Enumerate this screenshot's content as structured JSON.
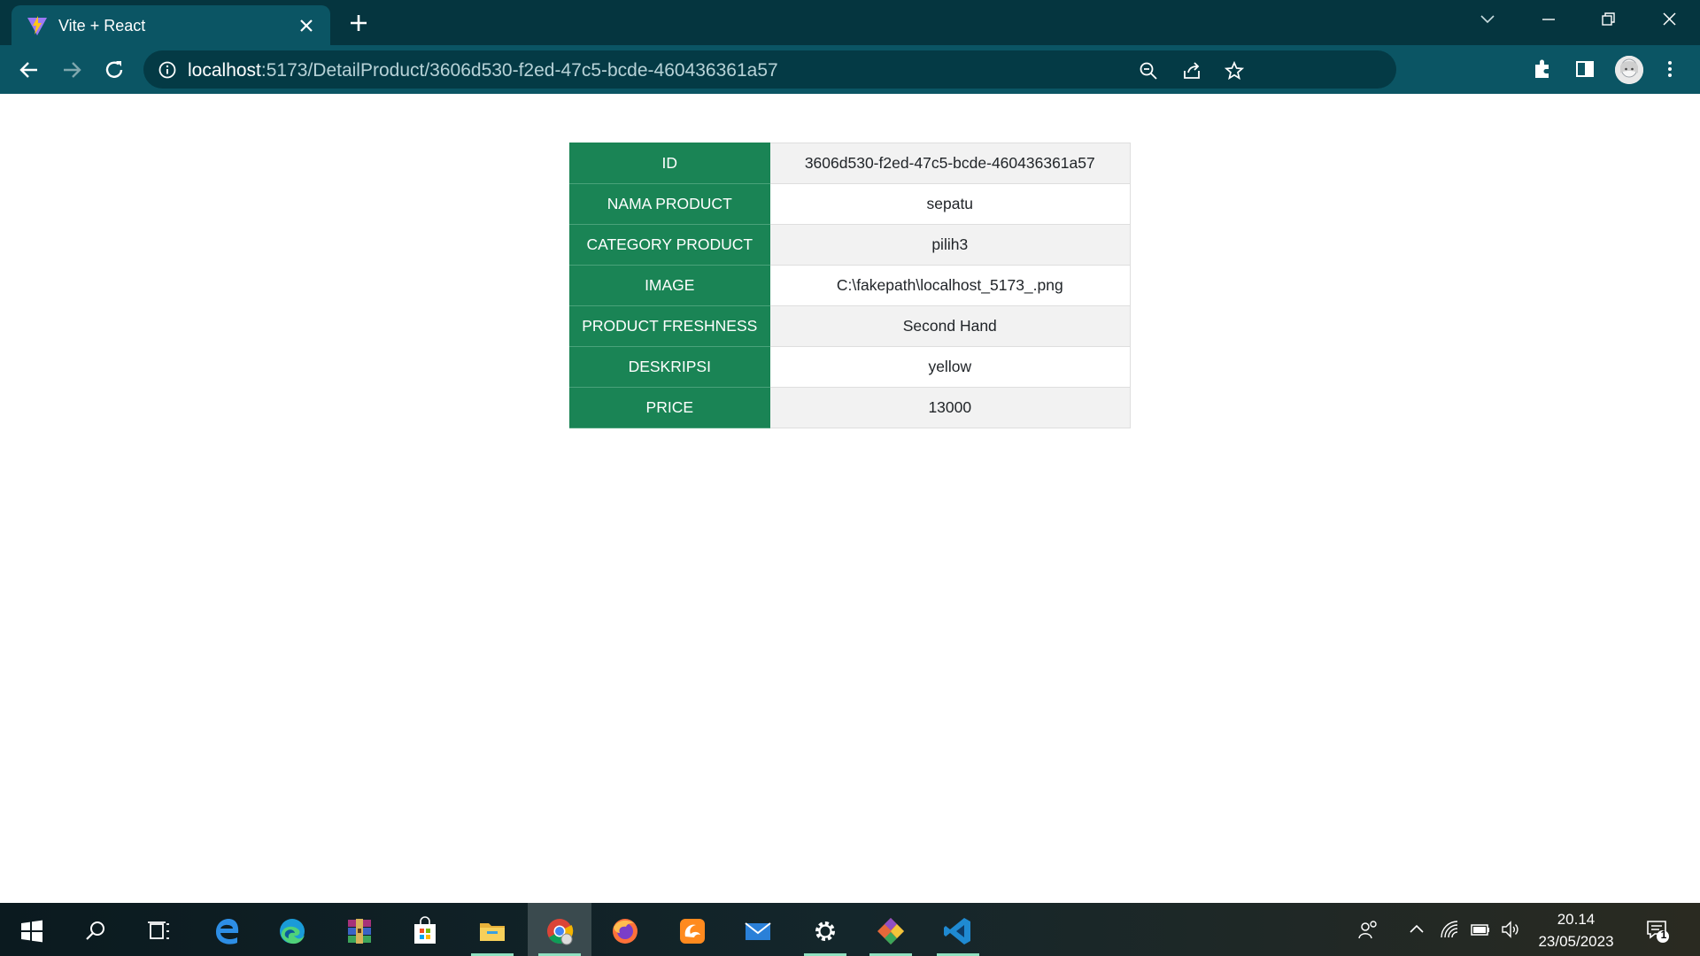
{
  "browser": {
    "tab_title": "Vite + React",
    "url_host": "localhost",
    "url_path": ":5173/DetailProduct/3606d530-f2ed-47c5-bcde-460436361a57"
  },
  "detail": {
    "rows": [
      {
        "key": "ID",
        "value": "3606d530-f2ed-47c5-bcde-460436361a57"
      },
      {
        "key": "NAMA PRODUCT",
        "value": "sepatu"
      },
      {
        "key": "CATEGORY PRODUCT",
        "value": "pilih3"
      },
      {
        "key": "IMAGE",
        "value": "C:\\fakepath\\localhost_5173_.png"
      },
      {
        "key": "PRODUCT FRESHNESS",
        "value": "Second Hand"
      },
      {
        "key": "DESKRIPSI",
        "value": "yellow"
      },
      {
        "key": "PRICE",
        "value": "13000"
      }
    ]
  },
  "taskbar": {
    "time": "20.14",
    "date": "23/05/2023",
    "notification_count": "1",
    "apps": [
      "windows-icon",
      "search-icon",
      "task-view-icon",
      "edge-legacy-icon",
      "edge-icon",
      "winrar-icon",
      "store-icon",
      "file-explorer-icon",
      "chrome-icon",
      "firefox-icon",
      "uc-browser-icon",
      "mail-icon",
      "settings-icon",
      "git-icon",
      "vscode-icon"
    ]
  },
  "colors": {
    "header_green": "#1a8455",
    "tabstrip": "#05353f",
    "toolbar": "#0b5564"
  }
}
